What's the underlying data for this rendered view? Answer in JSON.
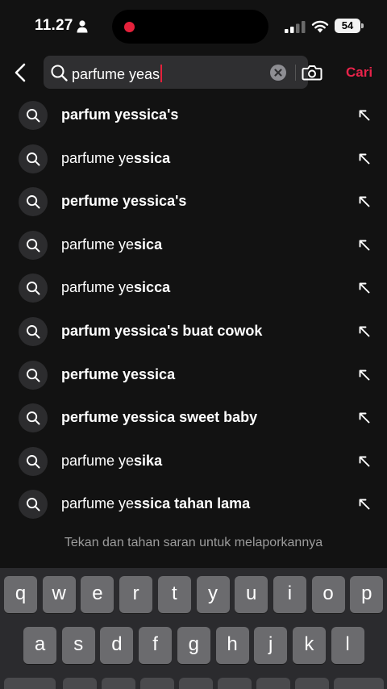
{
  "status_bar": {
    "time": "11.27",
    "battery": "54"
  },
  "search": {
    "query": "parfume yeas",
    "submit_label": "Cari"
  },
  "suggestions": [
    {
      "typed": "",
      "rest": "parfum yessica's"
    },
    {
      "typed": "parfume ye",
      "rest": "ssica"
    },
    {
      "typed": "",
      "rest": "perfume yessica's"
    },
    {
      "typed": "parfume ye",
      "rest": "sica"
    },
    {
      "typed": "parfume ye",
      "rest": "sicca"
    },
    {
      "typed": "",
      "rest": "parfum yessica's buat cowok"
    },
    {
      "typed": "",
      "rest": "perfume yessica"
    },
    {
      "typed": "",
      "rest": "perfume yessica sweet baby"
    },
    {
      "typed": "parfume ye",
      "rest": "sika"
    },
    {
      "typed": "parfume ye",
      "rest": "ssica tahan lama"
    }
  ],
  "hint": "Tekan dan tahan saran untuk melaporkannya",
  "keyboard": {
    "row1": [
      "q",
      "w",
      "e",
      "r",
      "t",
      "y",
      "u",
      "i",
      "o",
      "p"
    ],
    "row2": [
      "a",
      "s",
      "d",
      "f",
      "g",
      "h",
      "j",
      "k",
      "l"
    ]
  },
  "colors": {
    "background": "#121212",
    "accent": "#e8234a",
    "search_box": "#2f2f31",
    "key": "#6b6b6e"
  }
}
